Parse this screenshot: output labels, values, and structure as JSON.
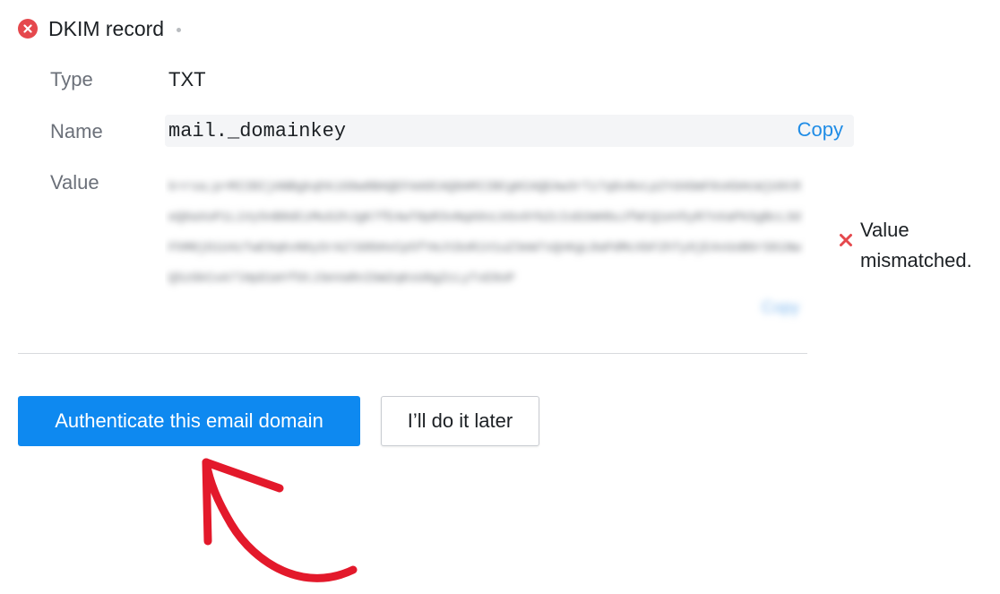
{
  "record": {
    "status": "error",
    "title": "DKIM record"
  },
  "fields": {
    "type_label": "Type",
    "type_value": "TXT",
    "name_label": "Name",
    "name_value": "mail._domainkey",
    "name_copy_label": "Copy",
    "value_label": "Value",
    "value_copy_label": "Copy"
  },
  "validation": {
    "line1": "Value",
    "line2": "mismatched."
  },
  "actions": {
    "primary_label": "Authenticate this email domain",
    "secondary_label": "I’ll do it later"
  },
  "colors": {
    "accent": "#0e89f0",
    "link": "#1f8ce6",
    "error": "#e5484d",
    "annotation_arrow": "#e3192b"
  },
  "icons": {
    "status": "error-circle-icon",
    "mismatch": "x-mark-icon",
    "annotation": "arrow-annotation-icon"
  }
}
